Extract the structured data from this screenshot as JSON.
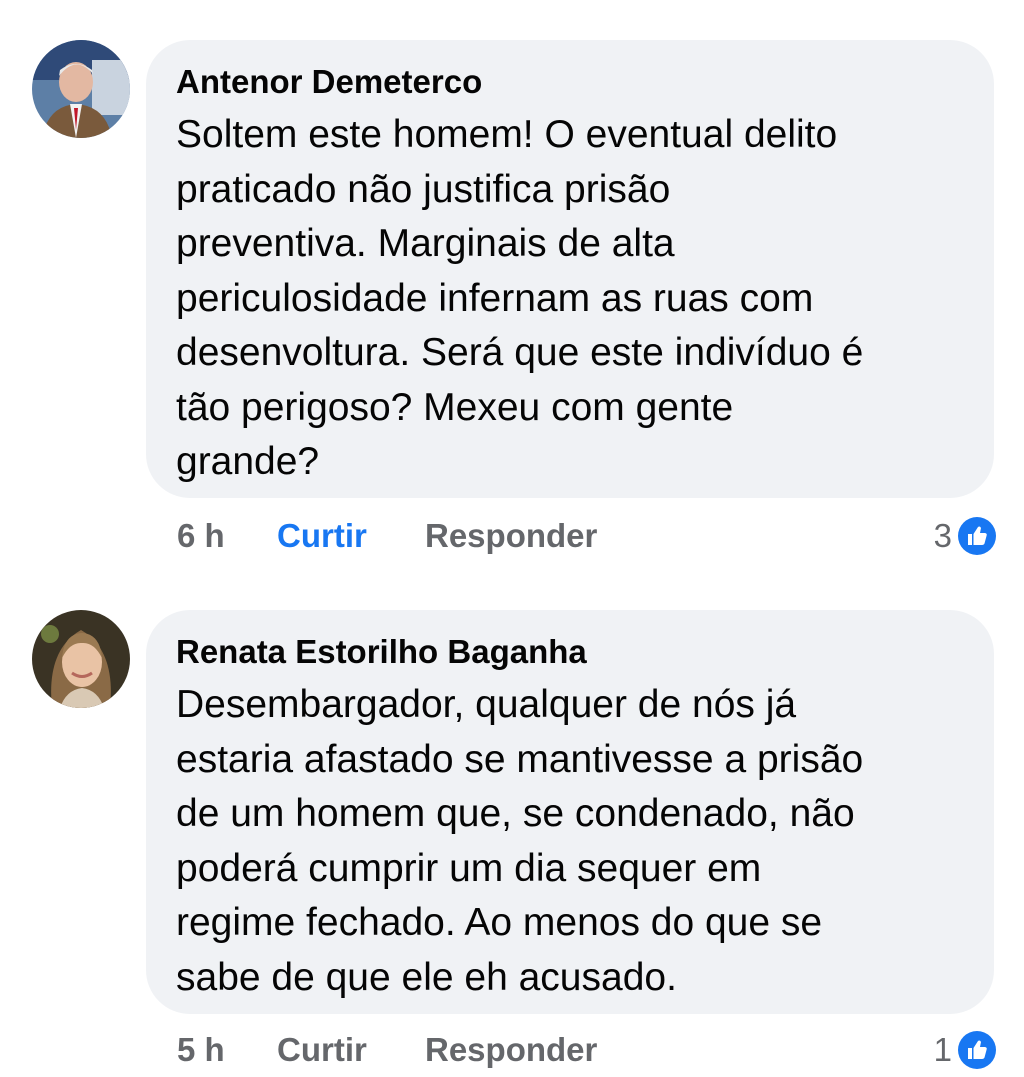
{
  "comments": [
    {
      "author": "Antenor Demeterco",
      "text_lines": [
        "Soltem este homem!  O eventual delito",
        "praticado não  justifica prisão",
        "preventiva. Marginais de alta",
        "periculosidade infernam as ruas com",
        "desenvoltura. Será  que este indivíduo  é",
        "tão  perigoso?  Mexeu com gente",
        "grande?"
      ],
      "time": "6 h",
      "like_label": "Curtir",
      "reply_label": "Responder",
      "reaction_count": "3",
      "liked": true,
      "like_color": "#1877f2"
    },
    {
      "author": "Renata Estorilho Baganha",
      "text_lines": [
        "Desembargador, qualquer de nós já",
        "estaria afastado se mantivesse a prisão",
        "de um homem que, se condenado, não",
        "poderá cumprir um dia sequer em",
        "regime fechado. Ao menos do que se",
        "sabe de que ele eh acusado."
      ],
      "time": "5 h",
      "like_label": "Curtir",
      "reply_label": "Responder",
      "reaction_count": "1",
      "liked": false
    }
  ],
  "icons": {
    "reaction": "thumbs-up-icon"
  },
  "colors": {
    "bubble": "#f0f2f5",
    "meta": "#65676b",
    "accent": "#1877f2"
  }
}
